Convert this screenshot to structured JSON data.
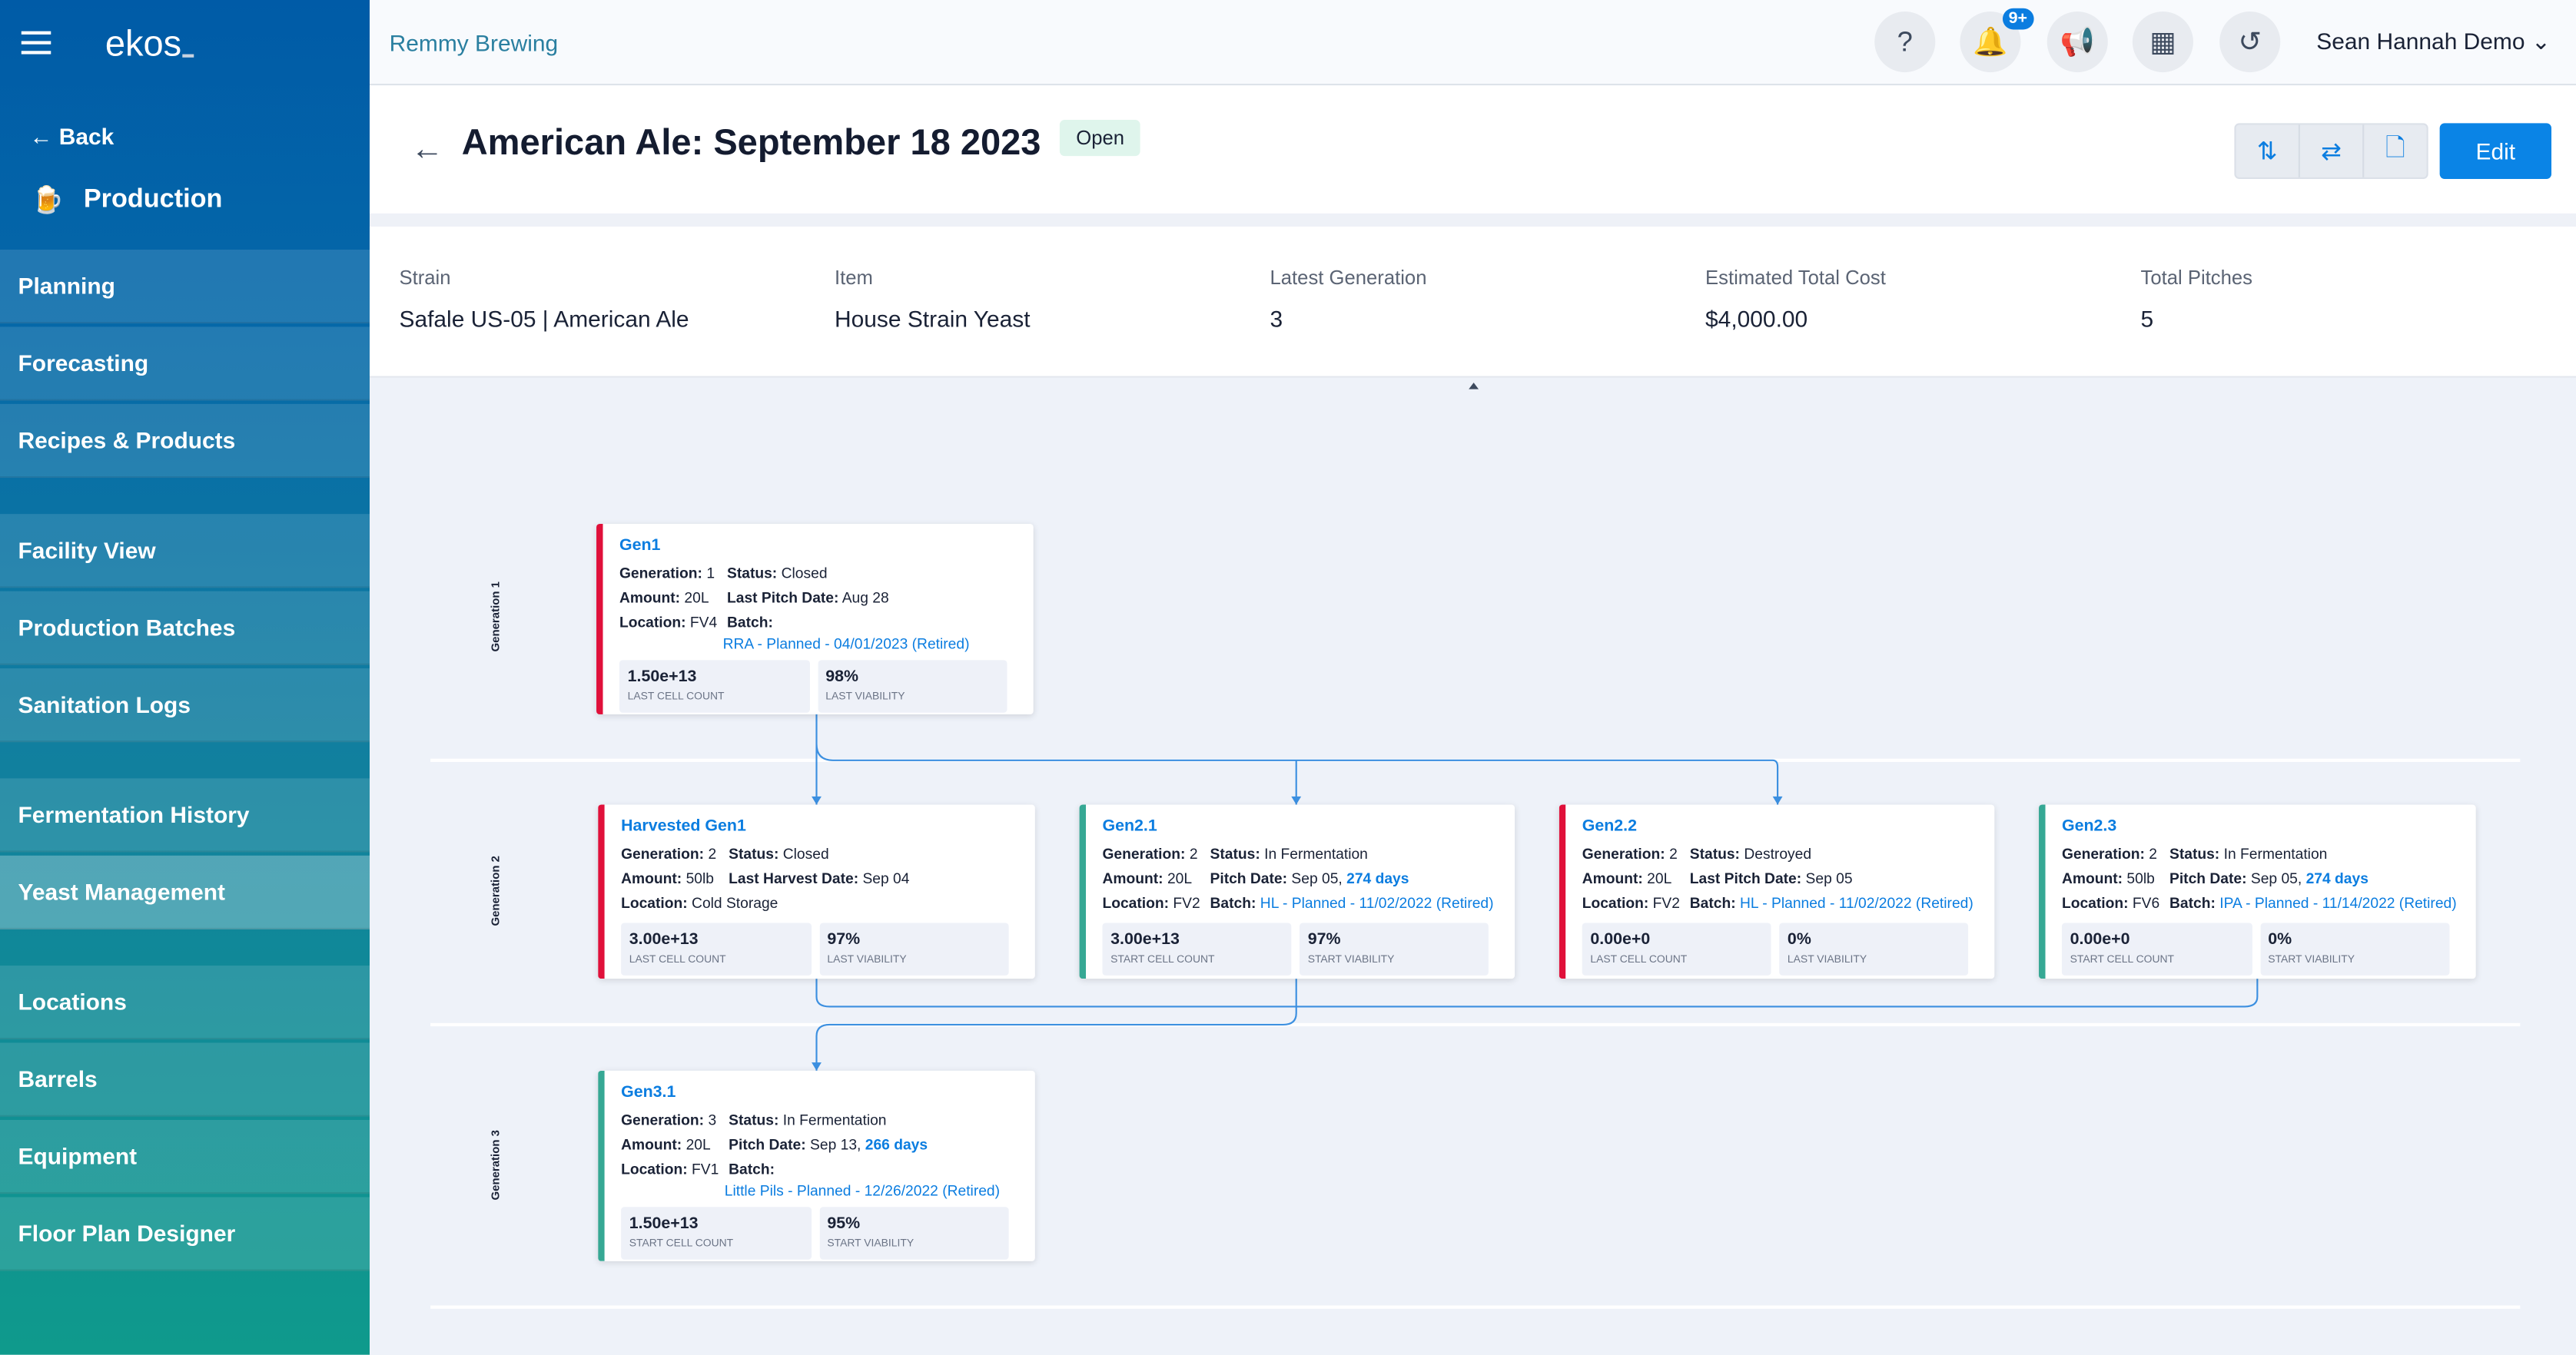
{
  "sidebar": {
    "logo": "ekos_",
    "back": "Back",
    "section": "Production",
    "items": [
      {
        "label": "Planning"
      },
      {
        "label": "Forecasting"
      },
      {
        "label": "Recipes & Products"
      },
      {
        "label": "Facility View"
      },
      {
        "label": "Production Batches"
      },
      {
        "label": "Sanitation Logs"
      },
      {
        "label": "Fermentation History"
      },
      {
        "label": "Yeast Management",
        "active": true
      },
      {
        "label": "Locations"
      },
      {
        "label": "Barrels"
      },
      {
        "label": "Equipment"
      },
      {
        "label": "Floor Plan Designer"
      }
    ]
  },
  "header": {
    "brand": "Remmy Brewing",
    "notifications_badge": "9+",
    "user": "Sean Hannah Demo"
  },
  "page": {
    "title": "American Ale: September 18 2023",
    "status": "Open",
    "edit": "Edit"
  },
  "info": [
    {
      "label": "Strain",
      "value": "Safale US-05 | American Ale"
    },
    {
      "label": "Item",
      "value": "House Strain Yeast"
    },
    {
      "label": "Latest Generation",
      "value": "3"
    },
    {
      "label": "Estimated Total Cost",
      "value": "$4,000.00"
    },
    {
      "label": "Total Pitches",
      "value": "5"
    }
  ],
  "generation_labels": [
    "Generation 1",
    "Generation 2",
    "Generation 3"
  ],
  "colors": {
    "closed": "#e0103a",
    "active": "#36a894",
    "accent": "#0b7de0"
  },
  "cards": [
    {
      "title": "Gen1",
      "color": "closed",
      "rows": [
        [
          "Generation:",
          "1",
          "Status:",
          "Closed"
        ],
        [
          "Amount:",
          "20L",
          "Last Pitch Date:",
          "Aug 28"
        ],
        [
          "Location:",
          "FV4",
          "Batch:",
          ""
        ]
      ],
      "batch_link": "RRA - Planned - 04/01/2023 (Retired)",
      "batch_newline": true,
      "metrics": [
        {
          "value": "1.50e+13",
          "label": "LAST CELL COUNT"
        },
        {
          "value": "98%",
          "label": "LAST VIABILITY"
        }
      ]
    },
    {
      "title": "Harvested Gen1",
      "color": "closed",
      "rows": [
        [
          "Generation:",
          "2",
          "Status:",
          "Closed"
        ],
        [
          "Amount:",
          "50lb",
          "Last Harvest Date:",
          "Sep 04"
        ],
        [
          "Location:",
          "Cold Storage",
          "",
          ""
        ]
      ],
      "metrics": [
        {
          "value": "3.00e+13",
          "label": "LAST CELL COUNT"
        },
        {
          "value": "97%",
          "label": "LAST VIABILITY"
        }
      ]
    },
    {
      "title": "Gen2.1",
      "color": "active",
      "rows": [
        [
          "Generation:",
          "2",
          "Status:",
          "In Fermentation"
        ],
        [
          "Amount:",
          "20L",
          "Pitch Date:",
          "Sep 05,"
        ],
        [
          "Location:",
          "FV2",
          "Batch:",
          ""
        ]
      ],
      "days": "274 days",
      "batch_link": "HL - Planned - 11/02/2022 (Retired)",
      "metrics": [
        {
          "value": "3.00e+13",
          "label": "START CELL COUNT"
        },
        {
          "value": "97%",
          "label": "START VIABILITY"
        }
      ]
    },
    {
      "title": "Gen2.2",
      "color": "closed",
      "rows": [
        [
          "Generation:",
          "2",
          "Status:",
          "Destroyed"
        ],
        [
          "Amount:",
          "20L",
          "Last Pitch Date:",
          "Sep 05"
        ],
        [
          "Location:",
          "FV2",
          "Batch:",
          ""
        ]
      ],
      "batch_link": "HL - Planned - 11/02/2022 (Retired)",
      "metrics": [
        {
          "value": "0.00e+0",
          "label": "LAST CELL COUNT"
        },
        {
          "value": "0%",
          "label": "LAST VIABILITY"
        }
      ]
    },
    {
      "title": "Gen2.3",
      "color": "active",
      "rows": [
        [
          "Generation:",
          "2",
          "Status:",
          "In Fermentation"
        ],
        [
          "Amount:",
          "50lb",
          "Pitch Date:",
          "Sep 05,"
        ],
        [
          "Location:",
          "FV6",
          "Batch:",
          ""
        ]
      ],
      "days": "274 days",
      "batch_link": "IPA - Planned - 11/14/2022 (Retired)",
      "metrics": [
        {
          "value": "0.00e+0",
          "label": "START CELL COUNT"
        },
        {
          "value": "0%",
          "label": "START VIABILITY"
        }
      ]
    },
    {
      "title": "Gen3.1",
      "color": "active",
      "rows": [
        [
          "Generation:",
          "3",
          "Status:",
          "In Fermentation"
        ],
        [
          "Amount:",
          "20L",
          "Pitch Date:",
          "Sep 13,"
        ],
        [
          "Location:",
          "FV1",
          "Batch:",
          ""
        ]
      ],
      "days": "266 days",
      "batch_link": "Little Pils - Planned - 12/26/2022 (Retired)",
      "batch_newline": true,
      "metrics": [
        {
          "value": "1.50e+13",
          "label": "START CELL COUNT"
        },
        {
          "value": "95%",
          "label": "START VIABILITY"
        }
      ]
    }
  ]
}
